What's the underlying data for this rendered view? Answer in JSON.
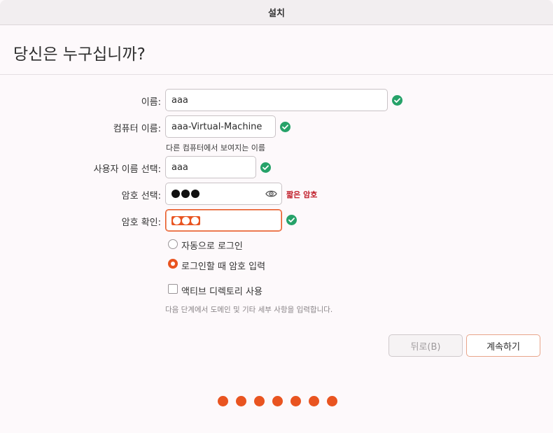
{
  "window": {
    "title": "설치"
  },
  "page": {
    "title": "당신은 누구십니까?"
  },
  "form": {
    "name": {
      "label": "이름:",
      "value": "aaa"
    },
    "computer_name": {
      "label": "컴퓨터 이름:",
      "value": "aaa-Virtual-Machine",
      "hint": "다른 컴퓨터에서 보여지는 이름"
    },
    "username": {
      "label": "사용자 이름 선택:",
      "value": "aaa"
    },
    "password": {
      "label": "암호 선택:",
      "strength": "짧은 암호"
    },
    "confirm_password": {
      "label": "암호 확인:"
    }
  },
  "login_options": {
    "auto_login": "자동으로 로그인",
    "require_password": "로그인할 때 암호 입력",
    "selected": "require_password"
  },
  "active_directory": {
    "label": "액티브 디렉토리 사용",
    "checked": false,
    "note": "다음 단계에서 도메인 및 기타 세부 사항을 입력합니다."
  },
  "buttons": {
    "back": "뒤로(B)",
    "next": "계속하기"
  },
  "progress": {
    "total": 7,
    "color": "#e95420"
  },
  "colors": {
    "accent": "#e95420",
    "success": "#26a269",
    "error": "#c01c28"
  }
}
